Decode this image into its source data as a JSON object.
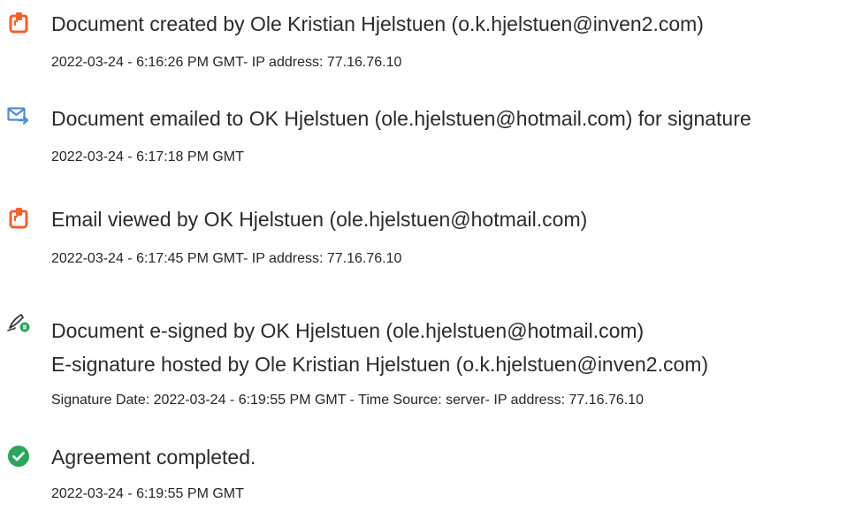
{
  "events": [
    {
      "icon": "document-created-icon",
      "title": "Document created by Ole Kristian Hjelstuen (o.k.hjelstuen@inven2.com)",
      "meta": "2022-03-24 - 6:16:26 PM GMT- IP address: 77.16.76.10"
    },
    {
      "icon": "email-sent-icon",
      "title": "Document emailed to OK Hjelstuen (ole.hjelstuen@hotmail.com) for signature",
      "meta": "2022-03-24 - 6:17:18 PM GMT"
    },
    {
      "icon": "document-viewed-icon",
      "title": "Email viewed by OK Hjelstuen (ole.hjelstuen@hotmail.com)",
      "meta": "2022-03-24 - 6:17:45 PM GMT- IP address: 77.16.76.10"
    },
    {
      "icon": "e-signed-icon",
      "title": "Document e-signed by OK Hjelstuen (ole.hjelstuen@hotmail.com)",
      "subtitle": "E-signature hosted by Ole Kristian Hjelstuen (o.k.hjelstuen@inven2.com)",
      "meta": "Signature Date: 2022-03-24 - 6:19:55 PM GMT - Time Source: server- IP address: 77.16.76.10"
    },
    {
      "icon": "completed-check-icon",
      "title": "Agreement completed.",
      "meta": "2022-03-24 - 6:19:55 PM GMT"
    }
  ],
  "colors": {
    "doc_icon": "#f0612c",
    "email_icon": "#4a8fd6",
    "sign_icon": "#3a3a3a",
    "sign_badge": "#29a65a",
    "check_icon": "#29a65a"
  }
}
